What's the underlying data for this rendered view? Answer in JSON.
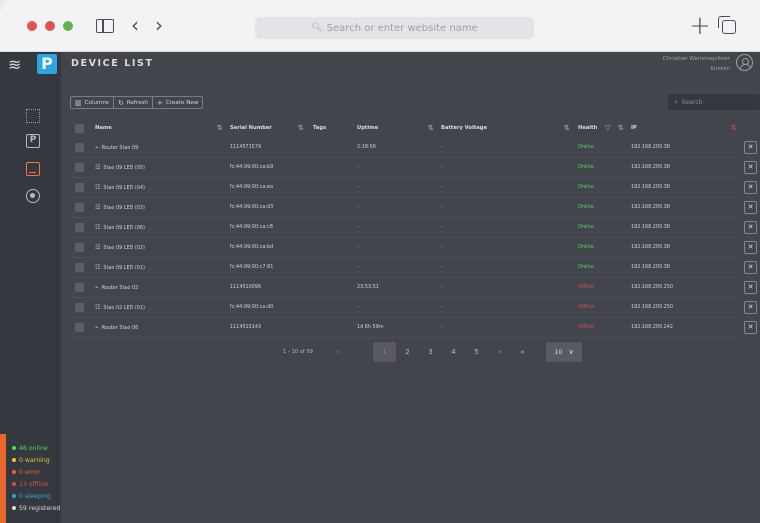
{
  "browser": {
    "url_placeholder": "Search or enter website name"
  },
  "app": {
    "title": "DEVICE LIST",
    "user": {
      "name": "Christian Weinmayrliner",
      "role": "Kirsten"
    },
    "colors": {
      "accent": "#e9672c",
      "brand": "#29a7e1",
      "online": "#4fd75c",
      "offline": "#e04a45"
    }
  },
  "toolbar": {
    "columns_label": "Columns",
    "refresh_label": "Refresh",
    "create_label": "Create New"
  },
  "search": {
    "placeholder": "Search"
  },
  "table": {
    "headers": {
      "name": "Name",
      "serial": "Serial Number",
      "tags": "Tags",
      "uptime": "Uptime",
      "battery": "Battery Voltage",
      "health": "Health",
      "ip": "IP"
    },
    "rows": [
      {
        "type": "router",
        "name": "Router Stao 09",
        "serial": "1114571579",
        "uptime": "2:18:56",
        "battery": "-",
        "health": "Online",
        "health_state": "online",
        "ip": "192.168.200.38"
      },
      {
        "type": "led",
        "name": "Stao 09 LED (05)",
        "serial": "fc:44:99:00:ca:b9",
        "uptime": "-",
        "battery": "-",
        "health": "Online",
        "health_state": "online",
        "ip": "192.168.200.38"
      },
      {
        "type": "led",
        "name": "Stao 09 LED (04)",
        "serial": "fc:44:99:00:ca:ea",
        "uptime": "-",
        "battery": "-",
        "health": "Online",
        "health_state": "online",
        "ip": "192.168.200.38"
      },
      {
        "type": "led",
        "name": "Stao 09 LED (03)",
        "serial": "fc:44:99:00:ca:d3",
        "uptime": "-",
        "battery": "-",
        "health": "Online",
        "health_state": "online",
        "ip": "192.168.200.38"
      },
      {
        "type": "led",
        "name": "Stao 09 LED (06)",
        "serial": "fc:44:99:00:ca:c8",
        "uptime": "-",
        "battery": "-",
        "health": "Online",
        "health_state": "online",
        "ip": "192.168.200.38"
      },
      {
        "type": "led",
        "name": "Stao 09 LED (02)",
        "serial": "fc:44:99:00:ca:bd",
        "uptime": "-",
        "battery": "-",
        "health": "Online",
        "health_state": "online",
        "ip": "192.168.200.38"
      },
      {
        "type": "led",
        "name": "Stao 09 LED (01)",
        "serial": "fc:44:99:00:c7:81",
        "uptime": "-",
        "battery": "-",
        "health": "Online",
        "health_state": "online",
        "ip": "192.168.200.38"
      },
      {
        "type": "router",
        "name": "Router Stao 02",
        "serial": "1114510096",
        "uptime": "23:53:51",
        "battery": "-",
        "health": "Offline",
        "health_state": "offline",
        "ip": "192.168.200.250"
      },
      {
        "type": "led",
        "name": "Stao 02 LED (01)",
        "serial": "fc:44:99:00:ca:d0",
        "uptime": "-",
        "battery": "-",
        "health": "Offline",
        "health_state": "offline",
        "ip": "192.168.200.250"
      },
      {
        "type": "router",
        "name": "Router Stao 06",
        "serial": "1114515143",
        "uptime": "1d 6h 59m",
        "battery": "-",
        "health": "Offline",
        "health_state": "offline",
        "ip": "192.168.200.242"
      }
    ]
  },
  "pagination": {
    "info": "1 - 10 of 59",
    "first": "«",
    "prev": "‹",
    "pages": [
      "1",
      "2",
      "3",
      "4",
      "5"
    ],
    "current": "1",
    "next": "›",
    "last": "»",
    "per_page": "10"
  },
  "status_summary": [
    {
      "label": "46 online",
      "color": "#4fd75c"
    },
    {
      "label": "0 warning",
      "color": "#e7c53a"
    },
    {
      "label": "0 error",
      "color": "#e9672c"
    },
    {
      "label": "13 offline",
      "color": "#e04a45"
    },
    {
      "label": "0 sleeping",
      "color": "#29a7e1"
    },
    {
      "label": "59 registered",
      "color": "#d9dbe0"
    }
  ]
}
